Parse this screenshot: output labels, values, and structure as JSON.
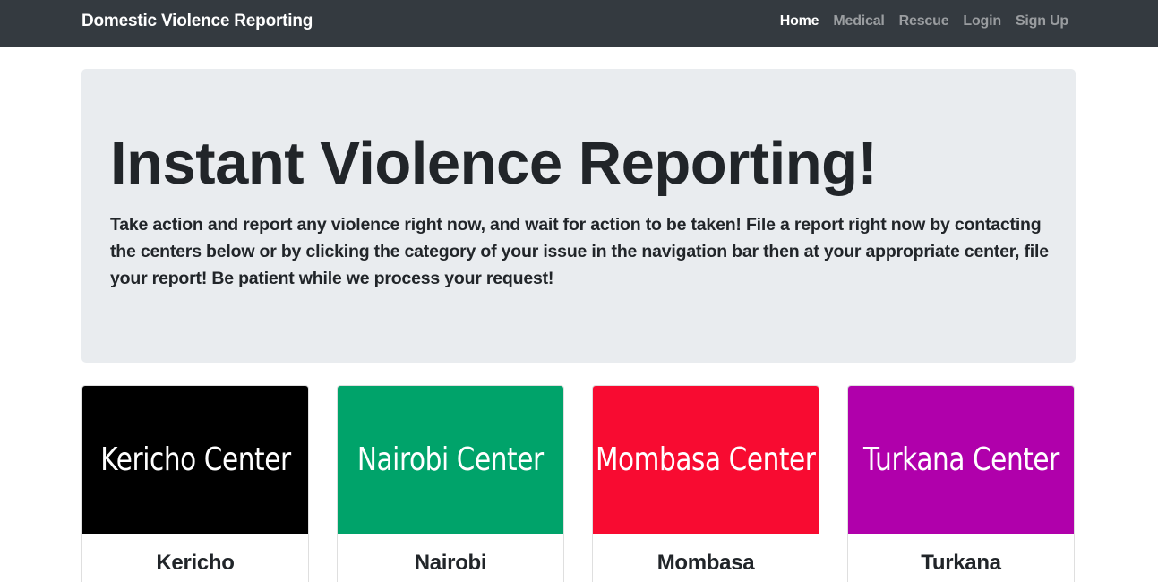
{
  "navbar": {
    "brand": "Domestic Violence Reporting",
    "links": [
      {
        "label": "Home",
        "active": true
      },
      {
        "label": "Medical",
        "active": false
      },
      {
        "label": "Rescue",
        "active": false
      },
      {
        "label": "Login",
        "active": false
      },
      {
        "label": "Sign Up",
        "active": false
      }
    ]
  },
  "hero": {
    "title": "Instant Violence Reporting!",
    "text": "Take action and report any violence right now, and wait for action to be taken! File a report right now by contacting the centers below or by clicking the category of your issue in the navigation bar then at your appropriate center, file your report! Be patient while we process your request!"
  },
  "centers": [
    {
      "image_text": "Kericho Center",
      "title": "Kericho",
      "color": "#000000"
    },
    {
      "image_text": "Nairobi Center",
      "title": "Nairobi",
      "color": "#00a36a"
    },
    {
      "image_text": "Mombasa Center",
      "title": "Mombasa",
      "color": "#f80b31"
    },
    {
      "image_text": "Turkana Center",
      "title": "Turkana",
      "color": "#b000ab"
    }
  ]
}
